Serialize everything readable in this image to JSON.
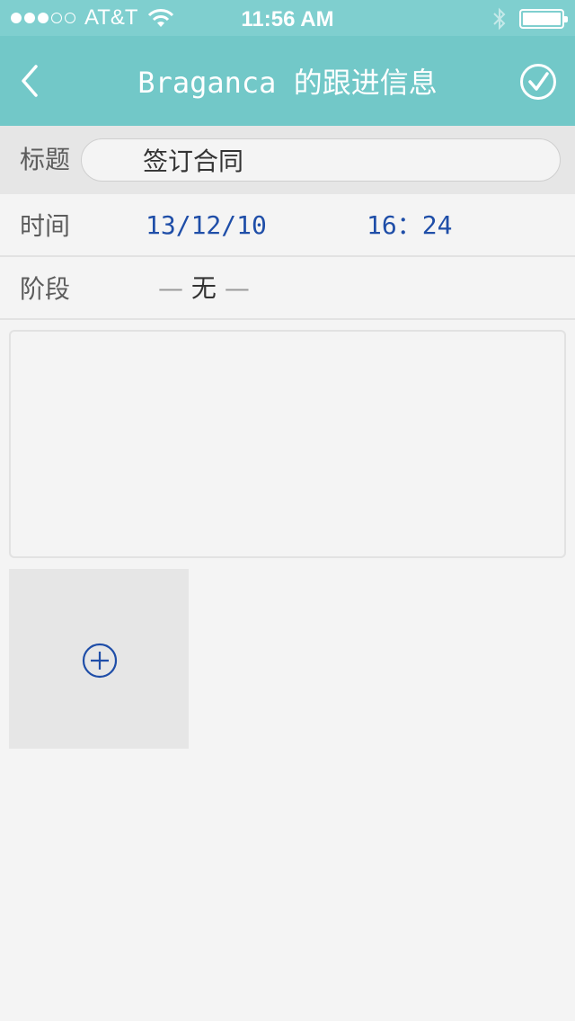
{
  "status_bar": {
    "signal": "●●●○○",
    "carrier": "AT&T",
    "time": "11:56 AM"
  },
  "nav": {
    "title": "Braganca 的跟进信息",
    "back_icon": "chevron-left-icon",
    "confirm_icon": "check-circle-icon"
  },
  "form": {
    "title_label": "标题",
    "title_value": "签订合同",
    "time_label": "时间",
    "date_value": "13/12/10",
    "time_value": "16：24",
    "stage_label": "阶段",
    "stage_value": "无",
    "notes_value": ""
  },
  "attachments": {
    "add_icon": "plus-circle-icon"
  },
  "colors": {
    "status_bar": "#7fcfcf",
    "nav_bar": "#72c8c8",
    "accent_blue": "#1f4ea8",
    "background": "#f4f4f4"
  }
}
